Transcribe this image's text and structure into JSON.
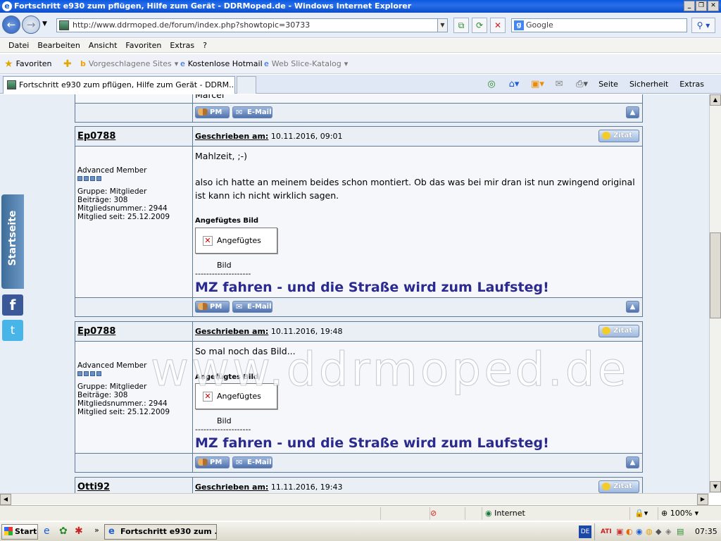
{
  "window": {
    "title": "Fortschritt e930 zum pflügen, Hilfe zum Gerät - DDRMoped.de - Windows Internet Explorer"
  },
  "address": {
    "url": "http://www.ddrmoped.de/forum/index.php?showtopic=30733",
    "search_placeholder": "Google"
  },
  "menu": [
    "Datei",
    "Bearbeiten",
    "Ansicht",
    "Favoriten",
    "Extras",
    "?"
  ],
  "favorites_bar": {
    "favorites": "Favoriten",
    "items": [
      "Vorgeschlagene Sites",
      "Kostenlose Hotmail",
      "Web Slice-Katalog"
    ]
  },
  "tab": {
    "title": "Fortschritt e930 zum pflügen, Hilfe zum Gerät - DDRM..."
  },
  "command_bar": {
    "page": "Seite",
    "security": "Sicherheit",
    "extras": "Extras"
  },
  "sidebar": {
    "startseite": "Startseite",
    "facebook": "f",
    "twitter": "t"
  },
  "partial_top": {
    "text": "Marcel"
  },
  "buttons": {
    "pm": "PM",
    "email": "E-Mail",
    "zitat": "Zitat"
  },
  "posts": [
    {
      "author": "Ep0788",
      "written_label": "Geschrieben am:",
      "date": "10.11.2016, 09:01",
      "rank": "Advanced Member",
      "group": "Gruppe: Mitglieder",
      "posts": "Beiträge: 308",
      "member_no": "Mitgliedsnummer.: 2944",
      "member_since": "Mitglied seit: 25.12.2009",
      "body_line1": "Mahlzeit, ;-)",
      "body_line2": "also ich hatte an meinem beides schon montiert. Ob das was bei mir dran ist nun zwingend original ist kann ich nicht wirklich sagen.",
      "attachment_label": "Angefügtes Bild",
      "attachment_alt": "Angefügtes Bild",
      "sig_dash": "--------------------",
      "signature": "MZ fahren - und die Straße wird zum Laufsteg!"
    },
    {
      "author": "Ep0788",
      "written_label": "Geschrieben am:",
      "date": "10.11.2016, 19:48",
      "rank": "Advanced Member",
      "group": "Gruppe: Mitglieder",
      "posts": "Beiträge: 308",
      "member_no": "Mitgliedsnummer.: 2944",
      "member_since": "Mitglied seit: 25.12.2009",
      "body_line1": "So mal noch das Bild...",
      "attachment_label": "Angefügtes Bild",
      "attachment_alt": "Angefügtes Bild",
      "sig_dash": "--------------------",
      "signature": "MZ fahren - und die Straße wird zum Laufsteg!"
    },
    {
      "author": "Otti92",
      "written_label": "Geschrieben am:",
      "date": "11.11.2016, 19:43"
    }
  ],
  "watermark": "www.ddrmoped.de",
  "status": {
    "zone": "Internet",
    "zoom": "100%"
  },
  "taskbar": {
    "start": "Start",
    "item": "Fortschritt e930 zum ...",
    "lang": "DE",
    "clock": "07:35"
  }
}
